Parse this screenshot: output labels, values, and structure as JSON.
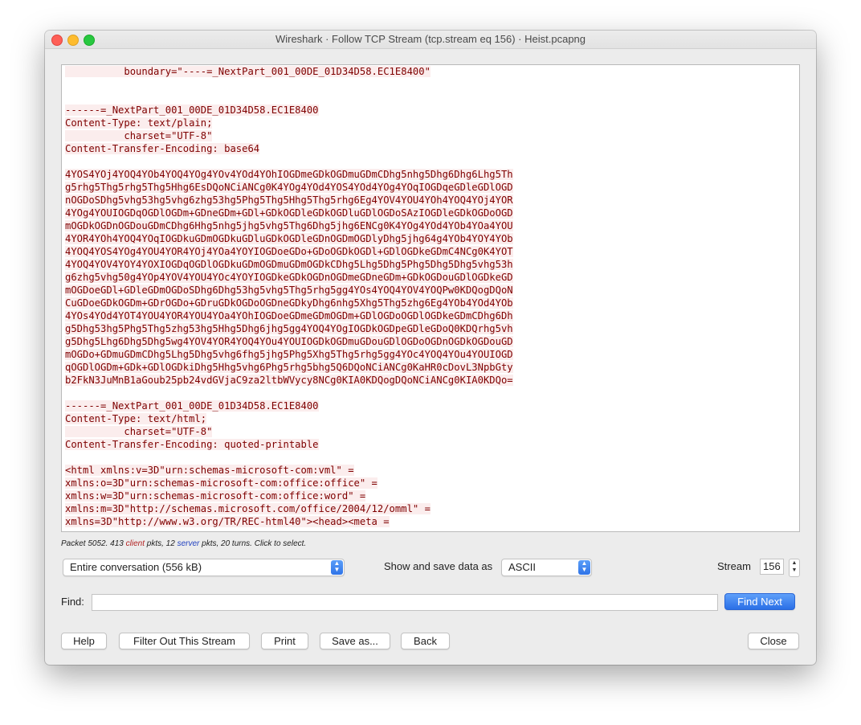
{
  "window": {
    "title": "Wireshark · Follow TCP Stream (tcp.stream eq 156) · Heist.pcapng"
  },
  "stream": {
    "lines": [
      "          boundary=\"----=_NextPart_001_00DE_01D34D58.EC1E8400\"",
      "",
      "",
      "------=_NextPart_001_00DE_01D34D58.EC1E8400",
      "Content-Type: text/plain;",
      "          charset=\"UTF-8\"",
      "Content-Transfer-Encoding: base64",
      "",
      "4YOS4YOj4YOQ4YOb4YOQ4YOg4YOv4YOd4YOhIOGDmeGDkOGDmuGDmCDhg5nhg5Dhg6Dhg6Lhg5Th",
      "g5rhg5Thg5rhg5Thg5Hhg6EsDQoNCiANCg0K4YOg4YOd4YOS4YOd4YOg4YOqIOGDqeGDleGDlOGD",
      "nOGDoSDhg5vhg53hg5vhg6zhg53hg5Phg5Thg5Hhg5Thg5rhg6Eg4YOV4YOU4YOh4YOQ4YOj4YOR",
      "4YOg4YOUIOGDqOGDlOGDm+GDneGDm+GDl+GDkOGDleGDkOGDluGDlOGDoSAzIOGDleGDkOGDoOGD",
      "mOGDkOGDnOGDouGDmCDhg6Hhg5nhg5jhg5vhg5Thg6Dhg5jhg6ENCg0K4YOg4YOd4YOb4YOa4YOU",
      "4YOR4YOh4YOQ4YOqIOGDkuGDmOGDkuGDluGDkOGDleGDnOGDmOGDlyDhg5jhg64g4YOb4YOY4YOb",
      "4YOQ4YOS4YOg4YOU4YOR4YOj4YOa4YOYIOGDoeGDo+GDoOGDkOGDl+GDlOGDkeGDmC4NCg0K4YOT",
      "4YOQ4YOV4YOY4YOXIOGDqOGDlOGDkuGDmOGDmuGDmOGDkCDhg5Lhg5Dhg5Phg5Dhg5Dhg5vhg53h",
      "g6zhg5vhg50g4YOp4YOV4YOU4YOc4YOYIOGDkeGDkOGDnOGDmeGDneGDm+GDkOGDouGDlOGDkeGD",
      "mOGDoeGDl+GDleGDmOGDoSDhg6Dhg53hg5vhg5Thg5rhg5gg4YOs4YOQ4YOV4YOQPw0KDQogDQoN",
      "CuGDoeGDkOGDm+GDrOGDo+GDruGDkOGDoOGDneGDkyDhg6nhg5Xhg5Thg5zhg6Eg4YOb4YOd4YOb",
      "4YOs4YOd4YOT4YOU4YOR4YOU4YOa4YOhIOGDoeGDmeGDmOGDm+GDlOGDoOGDlOGDkeGDmCDhg6Dh",
      "g5Dhg53hg5Phg5Thg5zhg53hg5Hhg5Dhg6jhg5gg4YOQ4YOgIOGDkOGDpeGDleGDoQ0KDQrhg5vh",
      "g5Dhg5Lhg6Dhg5Dhg5wg4YOV4YOR4YOQ4YOu4YOUIOGDkOGDmuGDouGDlOGDoOGDnOGDkOGDouGD",
      "mOGDo+GDmuGDmCDhg5Lhg5Dhg5vhg6fhg5jhg5Phg5Xhg5Thg5rhg5gg4YOc4YOQ4YOu4YOUIOGD",
      "qOGDlOGDm+GDk+GDlOGDkiDhg5Hhg5vhg6Phg5rhg5bhg5Q6DQoNCiANCg0KaHR0cDovL3NpbGty",
      "b2FkN3JuMnB1aGoub25pb24vdGVjaC9za2ltbWVycy8NCg0KIA0KDQogDQoNCiANCg0KIA0KDQo=",
      "",
      "------=_NextPart_001_00DE_01D34D58.EC1E8400",
      "Content-Type: text/html;",
      "          charset=\"UTF-8\"",
      "Content-Transfer-Encoding: quoted-printable",
      "",
      "<html xmlns:v=3D\"urn:schemas-microsoft-com:vml\" =",
      "xmlns:o=3D\"urn:schemas-microsoft-com:office:office\" =",
      "xmlns:w=3D\"urn:schemas-microsoft-com:office:word\" =",
      "xmlns:m=3D\"http://schemas.microsoft.com/office/2004/12/omml\" =",
      "xmlns=3D\"http://www.w3.org/TR/REC-html40\"><head><meta ="
    ]
  },
  "status": {
    "prefix": "Packet 5052. 413 ",
    "client": "client",
    "middle": " pkts, 12 ",
    "server": "server",
    "suffix": " pkts, 20 turns. Click to select."
  },
  "controls": {
    "conversation_select": "Entire conversation (556 kB)",
    "show_save_label": "Show and save data as",
    "format_select": "ASCII",
    "stream_label": "Stream",
    "stream_value": "156",
    "find_label": "Find:",
    "find_value": "",
    "find_next": "Find Next"
  },
  "buttons": {
    "help": "Help",
    "filter_out": "Filter Out This Stream",
    "print": "Print",
    "save_as": "Save as...",
    "back": "Back",
    "close": "Close"
  }
}
